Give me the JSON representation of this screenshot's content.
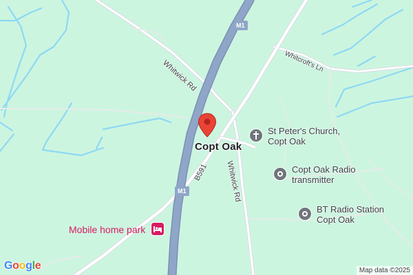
{
  "map": {
    "colors": {
      "background": "#ccf5e0",
      "water": "#8ed8f3",
      "motorway": "#8fa6c8",
      "motorway_edge": "#7a90b3",
      "road": "#ffffff",
      "road_edge": "#d8dde3",
      "pin": "#ea4335",
      "poi_grey": "#70757a",
      "leisure": "#d81b60"
    },
    "place": {
      "name": "Copt Oak"
    },
    "roads": {
      "whitwick_rd_nw": "Whitwick Rd",
      "whitwick_rd_s": "Whitwick Rd",
      "whitcrofts_ln": "Whitcroft's Ln",
      "b591": "B591",
      "m1_north": "M1",
      "m1_south": "M1"
    },
    "pois": [
      {
        "line1": "St Peter's Church,",
        "line2": "Copt Oak",
        "icon": "church-cross-icon"
      },
      {
        "line1": "Copt Oak Radio",
        "line2": "transmitter",
        "icon": "poi-pin-icon"
      },
      {
        "line1": "BT Radio Station",
        "line2": "Copt Oak",
        "icon": "poi-pin-icon"
      }
    ],
    "leisure_poi": {
      "label": "Mobile home park",
      "icon": "bed-icon"
    },
    "logo": {
      "G": "G",
      "o1": "o",
      "o2": "o",
      "g": "g",
      "l": "l",
      "e": "e"
    },
    "attribution": "Map data ©2025"
  }
}
